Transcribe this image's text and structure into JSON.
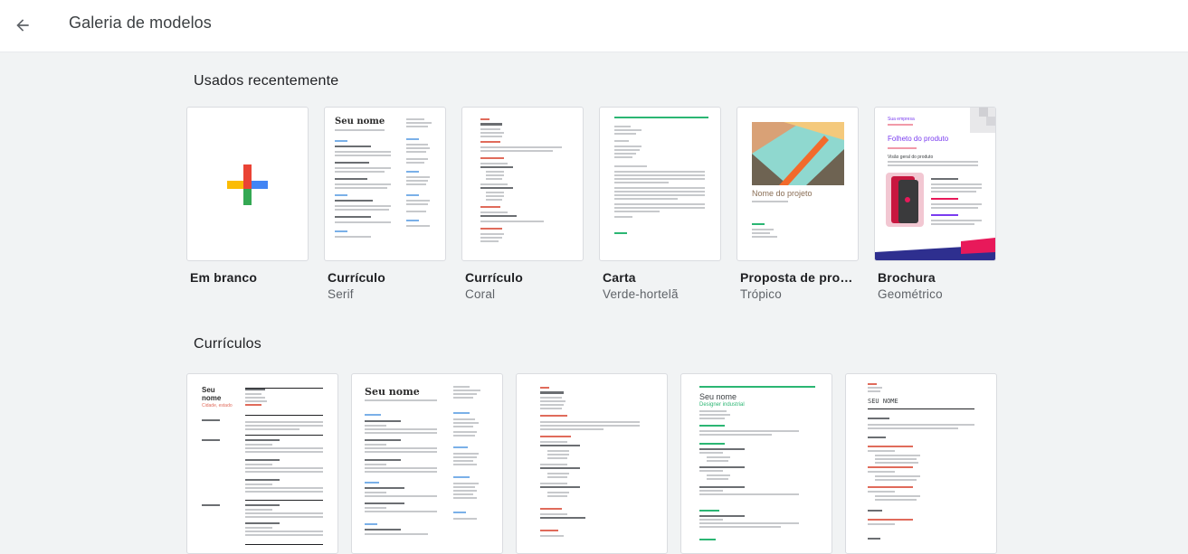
{
  "header": {
    "title": "Galeria de modelos",
    "back_icon": "arrow-back-icon"
  },
  "recent": {
    "title": "Usados recentemente",
    "items": [
      {
        "name": "Em branco",
        "sub": ""
      },
      {
        "name": "Currículo",
        "sub": "Serif"
      },
      {
        "name": "Currículo",
        "sub": "Coral"
      },
      {
        "name": "Carta",
        "sub": "Verde-hortelã"
      },
      {
        "name": "Proposta de proj…",
        "sub": "Trópico"
      },
      {
        "name": "Brochura",
        "sub": "Geométrico"
      }
    ]
  },
  "resumes": {
    "title": "Currículos"
  },
  "thumb_text": {
    "serif_name": "Seu nome",
    "proposal_title": "Nome do projeto",
    "brochure_company": "Sua empresa",
    "brochure_title": "Folheto do produto",
    "brochure_sub": "Visão geral do produto",
    "res1_name": "Seu\nnome",
    "res1_role": "Cidade, estado",
    "res2_name": "Seu nome",
    "res4_name": "Seu nome",
    "res4_role": "Designer industrial",
    "res5_name": "SEU NOME"
  },
  "colors": {
    "plus_red": "#ea4335",
    "plus_blue": "#4285f4",
    "plus_green": "#34a853",
    "plus_yellow": "#fbbc04",
    "coral": "#e06b5b",
    "mint": "#2bb673",
    "brochure_purple": "#7a3cf0",
    "brochure_pink": "#e8195a"
  }
}
